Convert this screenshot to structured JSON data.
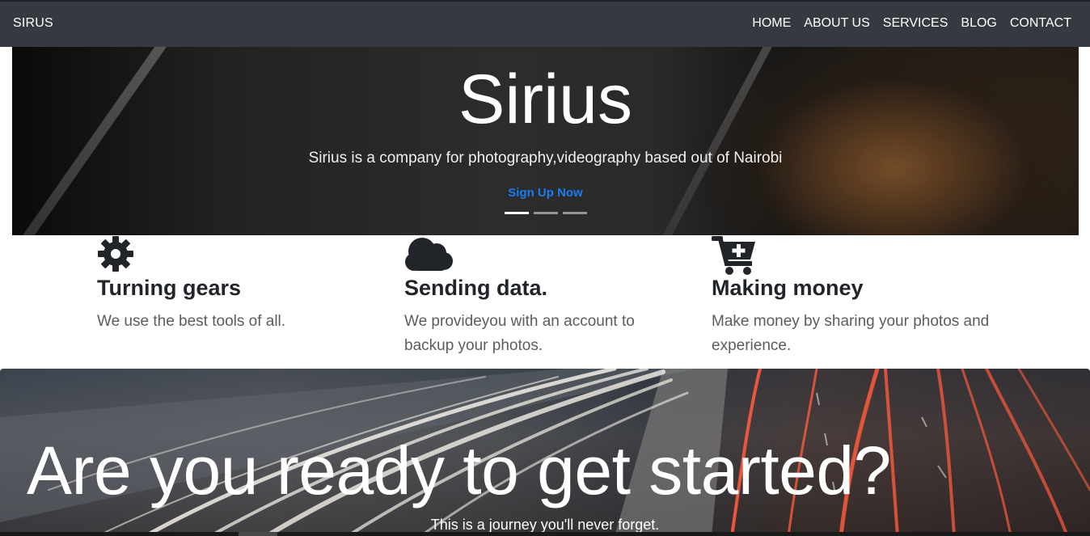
{
  "navbar": {
    "brand": "SIRUS",
    "links": [
      "HOME",
      "ABOUT US",
      "SERVICES",
      "BLOG",
      "CONTACT"
    ]
  },
  "hero": {
    "title": "Sirius",
    "subtitle": "Sirius is a company for photography,videography based out of Nairobi",
    "cta": "Sign Up Now",
    "active_slide": 1,
    "slide_count": 3
  },
  "features": [
    {
      "icon": "gear-icon",
      "title": "Turning gears",
      "text": "We use the best tools of all."
    },
    {
      "icon": "cloud-icon",
      "title": "Sending data.",
      "text": "We provideyou with an account to backup your photos."
    },
    {
      "icon": "cart-plus-icon",
      "title": "Making money",
      "text": "Make money by sharing your photos and experience."
    }
  ],
  "cta_section": {
    "title": "Are you ready to get started?",
    "subtitle": "This is a journey you'll never forget."
  },
  "colors": {
    "navbar_bg": "#343a40",
    "link_accent": "#1a7cf2",
    "heading": "#212529",
    "body_text": "#5c5c5c"
  }
}
